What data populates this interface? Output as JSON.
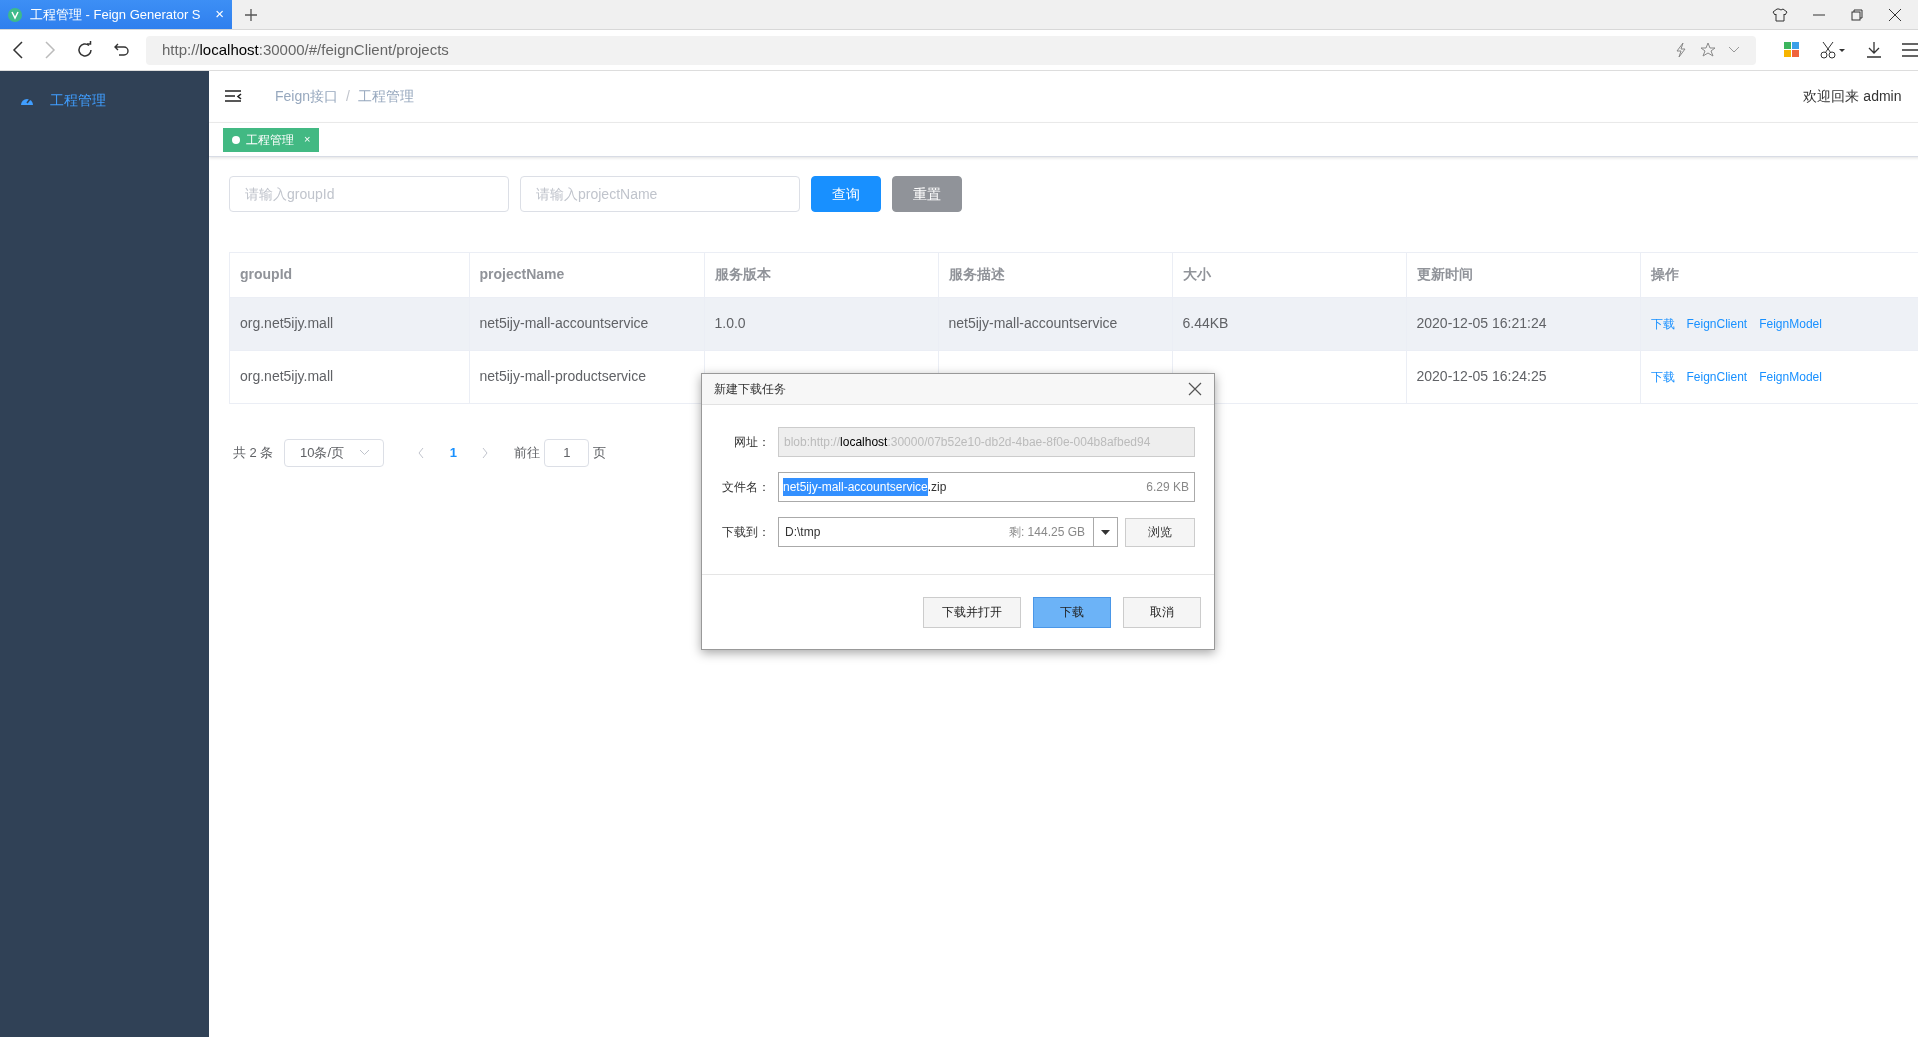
{
  "browser": {
    "tab_title": "工程管理 - Feign Generator S",
    "tab_close": "×",
    "url": "http://**localhost**:30000/#/feignClient/projects"
  },
  "sidebar": {
    "items": [
      {
        "label": "工程管理",
        "selected": true
      }
    ]
  },
  "header": {
    "breadcrumb": [
      "Feign接口",
      "工程管理"
    ],
    "separator": "/",
    "welcome": "欢迎回来 admin"
  },
  "tags": [
    {
      "label": "工程管理",
      "selected": true,
      "close": "×"
    }
  ],
  "filters": {
    "fields": [
      {
        "placeholder": "请输入groupId"
      },
      {
        "placeholder": "请输入projectName"
      }
    ],
    "buttons": [
      {
        "label": "查询",
        "kind": "primary"
      },
      {
        "label": "重置",
        "kind": "secondary"
      }
    ]
  },
  "table": {
    "columns": [
      "groupId",
      "projectName",
      "服务版本",
      "服务描述",
      "大小",
      "更新时间",
      "操作"
    ],
    "rows": [
      {
        "selected": true,
        "cells": [
          "org.net5ijy.mall",
          "net5ijy-mall-accountservice",
          "1.0.0",
          "net5ijy-mall-accountservice",
          "6.44KB",
          "2020-12-05 16:21:24"
        ],
        "actions": [
          "下载",
          "FeignClient",
          "FeignModel"
        ]
      },
      {
        "selected": false,
        "cells": [
          "org.net5ijy.mall",
          "net5ijy-mall-productservice",
          null,
          null,
          null,
          "2020-12-05 16:24:25"
        ],
        "actions": [
          "下载",
          "FeignClient",
          "FeignModel"
        ]
      }
    ]
  },
  "pagination": {
    "total": "共 2 条",
    "page_size": "10条/页",
    "pages": [
      {
        "label": "1",
        "selected": true
      }
    ],
    "goto_label": "前往",
    "goto_value": "1",
    "goto_suffix": "页"
  },
  "dialog": {
    "title": "新建下载任务",
    "url_label": "网址：",
    "url_value": "blob:http://**localhost**:30000/07b52e10-db2d-4bae-8f0e-004b8afbed94",
    "filename_label": "文件名：",
    "filename_highlighted": "net5ijy-mall-accountservice",
    "filename_rest": ".zip",
    "file_size": "6.29 KB",
    "save_label": "下载到：",
    "save_path": "D:\\tmp",
    "free_space": "剩: 144.25 GB",
    "browse": "浏览",
    "buttons": [
      {
        "label": "下载并打开",
        "kind": "default"
      },
      {
        "label": "下载",
        "kind": "primary"
      },
      {
        "label": "取消",
        "kind": "default"
      }
    ]
  }
}
